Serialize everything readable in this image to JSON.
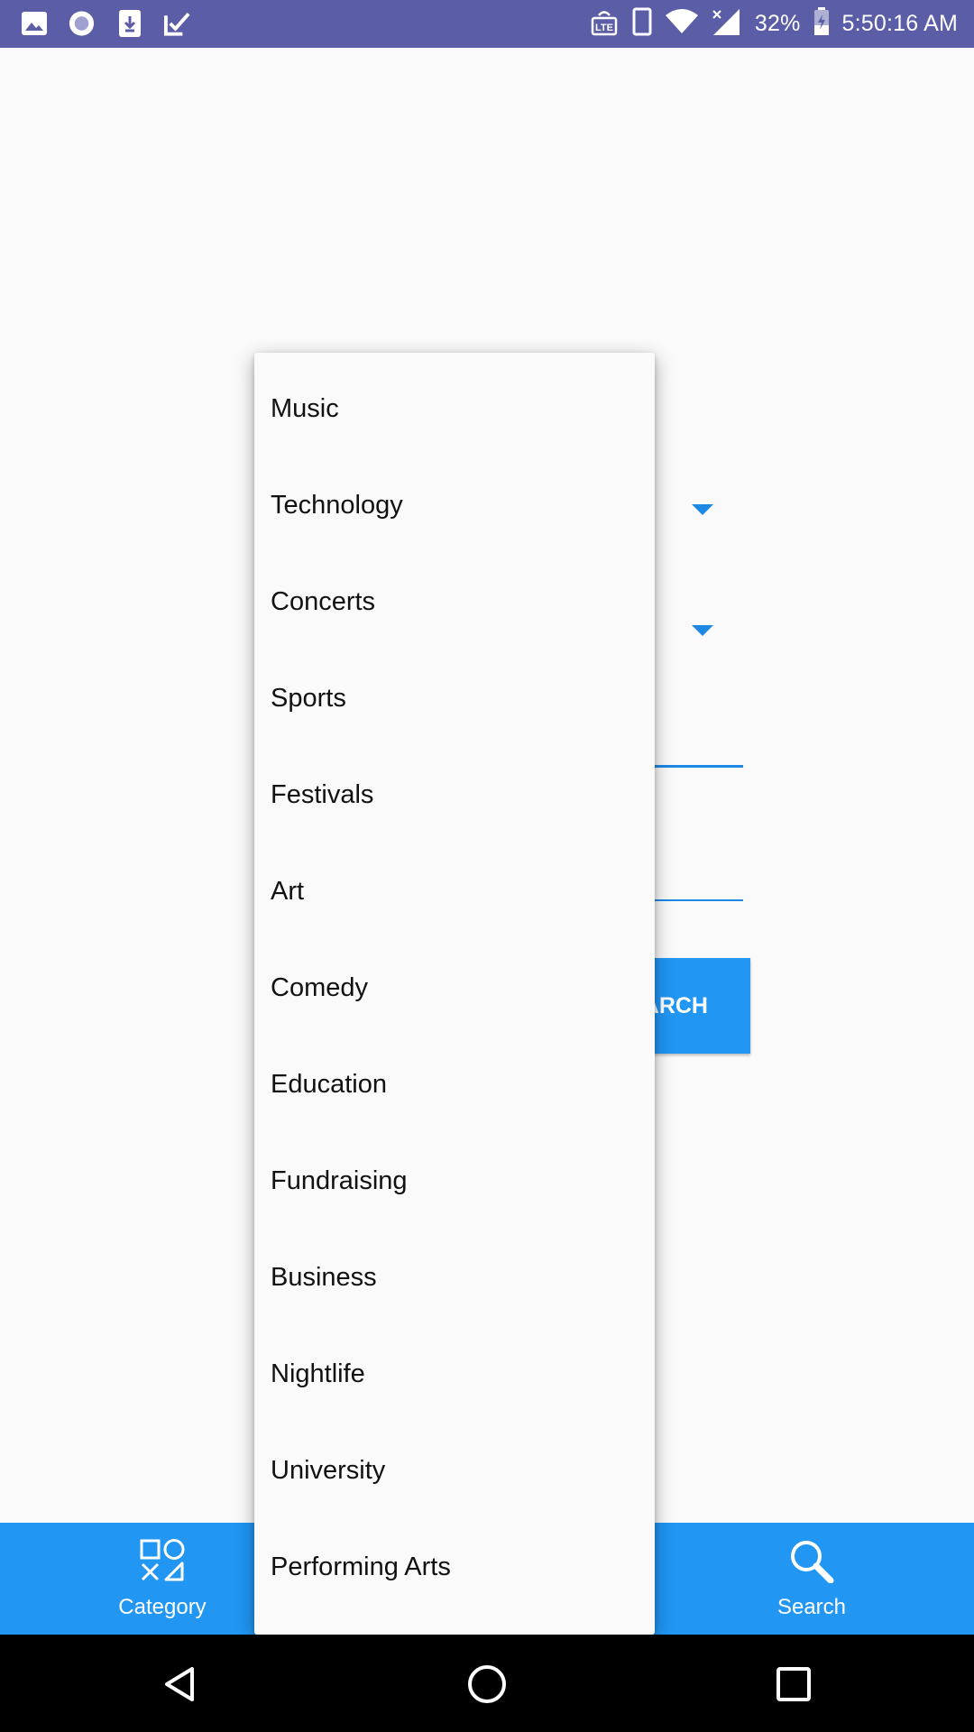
{
  "status_bar": {
    "battery": "32%",
    "time": "5:50:16 AM",
    "left_icons": [
      "image-icon",
      "record-icon",
      "download-icon",
      "check-icon"
    ],
    "right_icons": [
      "volte-icon",
      "phone-icon",
      "wifi-icon",
      "signal-icon",
      "battery-icon"
    ]
  },
  "form": {
    "search_button_label": "SEARCH"
  },
  "dropdown": {
    "items": [
      {
        "label": "Music"
      },
      {
        "label": "Technology"
      },
      {
        "label": "Concerts"
      },
      {
        "label": "Sports"
      },
      {
        "label": "Festivals"
      },
      {
        "label": "Art"
      },
      {
        "label": "Comedy"
      },
      {
        "label": "Education"
      },
      {
        "label": "Fundraising"
      },
      {
        "label": "Business"
      },
      {
        "label": "Nightlife"
      },
      {
        "label": "University"
      },
      {
        "label": "Performing Arts"
      }
    ]
  },
  "bottom_nav": {
    "category_label": "Category",
    "search_label": "Search"
  },
  "colors": {
    "status_bar": "#5b5ea6",
    "accent": "#2196f3",
    "dropdown_arrow": "#1e88e5",
    "system_nav": "#000000"
  }
}
